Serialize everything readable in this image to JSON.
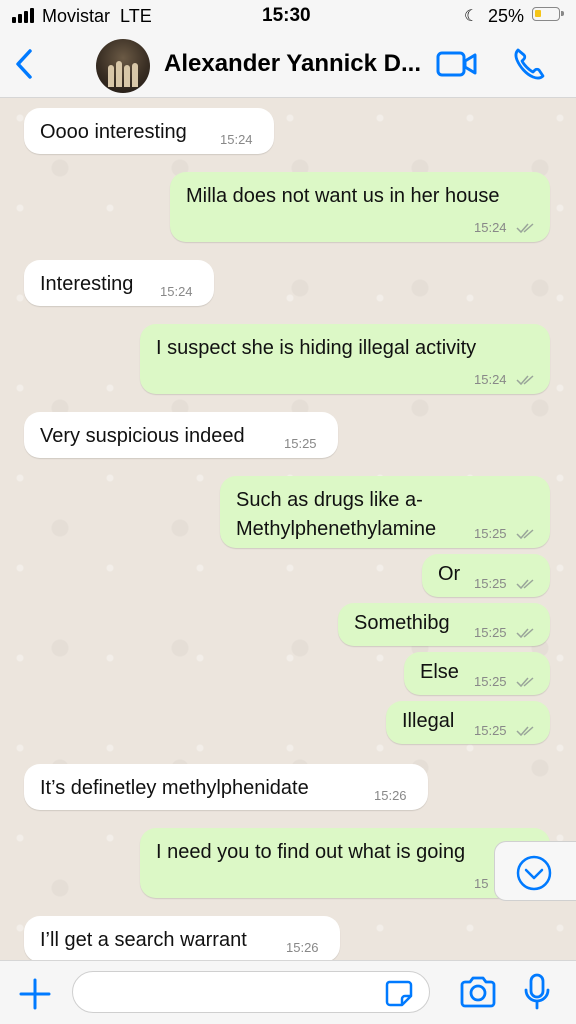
{
  "status_bar": {
    "carrier": "Movistar",
    "network": "LTE",
    "time": "15:30",
    "battery_percent": "25%",
    "battery_level": 0.25,
    "icons": [
      "signal-icon",
      "moon-icon",
      "battery-icon"
    ]
  },
  "header": {
    "contact_name": "Alexander Yannick D...",
    "icons": [
      "back-icon",
      "avatar",
      "video-call-icon",
      "phone-icon"
    ]
  },
  "messages": [
    {
      "dir": "in",
      "text": "Oooo interesting",
      "time": "15:24"
    },
    {
      "dir": "out",
      "text": "Milla does not want us in her house",
      "time": "15:24"
    },
    {
      "dir": "in",
      "text": "Interesting",
      "time": "15:24"
    },
    {
      "dir": "out",
      "text": "I suspect she is hiding illegal activity",
      "time": "15:24"
    },
    {
      "dir": "in",
      "text": "Very suspicious indeed",
      "time": "15:25"
    },
    {
      "dir": "out",
      "text": "Such as drugs like a-\nMethylphenethylamine",
      "time": "15:25"
    },
    {
      "dir": "out",
      "text": "Or",
      "time": "15:25"
    },
    {
      "dir": "out",
      "text": "Somethibg",
      "time": "15:25"
    },
    {
      "dir": "out",
      "text": "Else",
      "time": "15:25"
    },
    {
      "dir": "out",
      "text": "Illegal",
      "time": "15:25"
    },
    {
      "dir": "in",
      "text": "It’s definetley methylphenidate",
      "time": "15:26"
    },
    {
      "dir": "out",
      "text": "I need you to find out what is going",
      "time": "15"
    },
    {
      "dir": "in",
      "text": "I’ll get a search warrant",
      "time": "15:26"
    }
  ],
  "composer": {
    "placeholder": "",
    "icons": [
      "plus-icon",
      "sticker-icon",
      "camera-icon",
      "microphone-icon"
    ]
  },
  "colors": {
    "accent": "#007aff",
    "outgoing_bubble": "#dcf8c6",
    "incoming_bubble": "#ffffff",
    "chat_background": "#ece5dd",
    "read_ticks": "#9aa59a"
  }
}
